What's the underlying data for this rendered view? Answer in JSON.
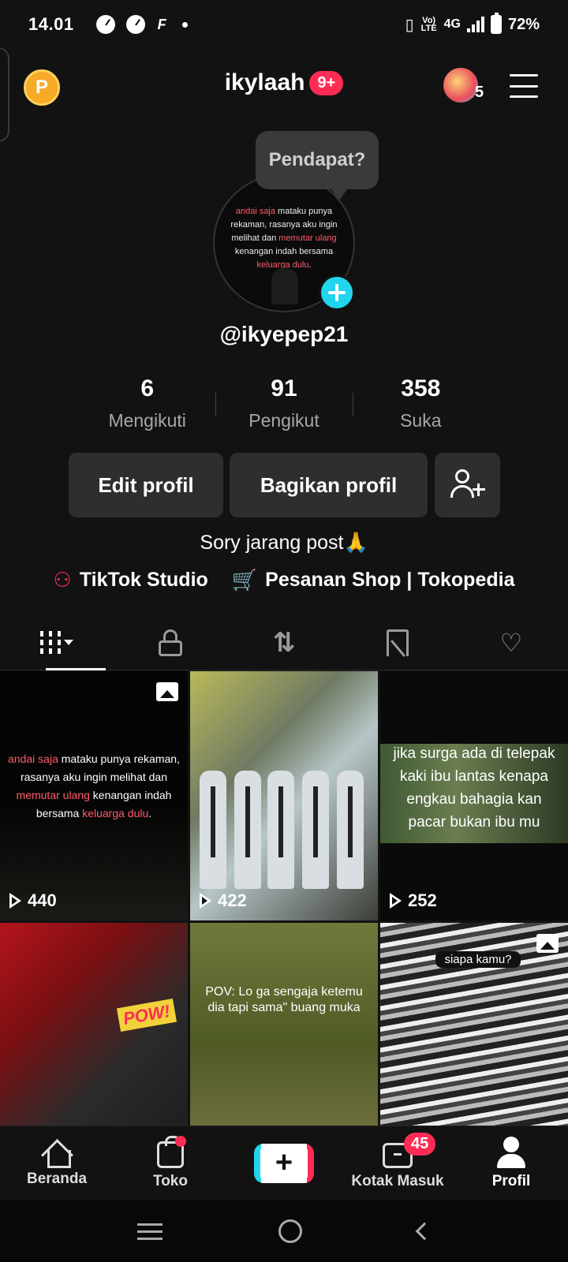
{
  "status_bar": {
    "time": "14.01",
    "network": "4G",
    "volte": "Vo) LTE",
    "battery": "72%"
  },
  "header": {
    "username": "ikylaah",
    "notif_badge": "9+",
    "avatar_count": "5",
    "coin_letter": "P"
  },
  "profile": {
    "tooltip": "Pendapat?",
    "handle": "@ikyepep21",
    "pic_text": {
      "p1": "andai saja",
      "p2": " mataku punya rekaman, rasanya aku ingin melihat dan ",
      "p3": "memutar ulang",
      "p4": " kenangan indah bersama ",
      "p5": "keluarga dulu",
      "p6": "."
    }
  },
  "stats": [
    {
      "value": "6",
      "label": "Mengikuti"
    },
    {
      "value": "91",
      "label": "Pengikut"
    },
    {
      "value": "358",
      "label": "Suka"
    }
  ],
  "buttons": {
    "edit": "Edit profil",
    "share": "Bagikan profil"
  },
  "bio": "Sory jarang post🙏",
  "links": {
    "studio": "TikTok Studio",
    "shop": "Pesanan Shop | Tokopedia"
  },
  "tabs": [
    "videos-grid-icon",
    "lock-icon",
    "repost-icon",
    "bookmark-icon",
    "liked-icon"
  ],
  "grid": [
    {
      "views": "440",
      "text_parts": [
        "andai saja",
        " mataku punya rekaman, rasanya aku ingin melihat dan ",
        "memutar ulang",
        " kenangan indah bersama ",
        "keluarga dulu",
        "."
      ]
    },
    {
      "views": "422"
    },
    {
      "views": "252",
      "text": "jika surga ada di telepak kaki ibu lantas kenapa engkau bahagia kan pacar bukan ibu mu"
    },
    {
      "overlay": "POW!"
    },
    {
      "text": "POV: Lo ga sengaja ketemu dia tapi sama\" buang muka"
    },
    {
      "text": "siapa kamu?"
    }
  ],
  "bottom_nav": {
    "home": "Beranda",
    "shop": "Toko",
    "inbox": "Kotak Masuk",
    "inbox_badge": "45",
    "profile": "Profil"
  }
}
